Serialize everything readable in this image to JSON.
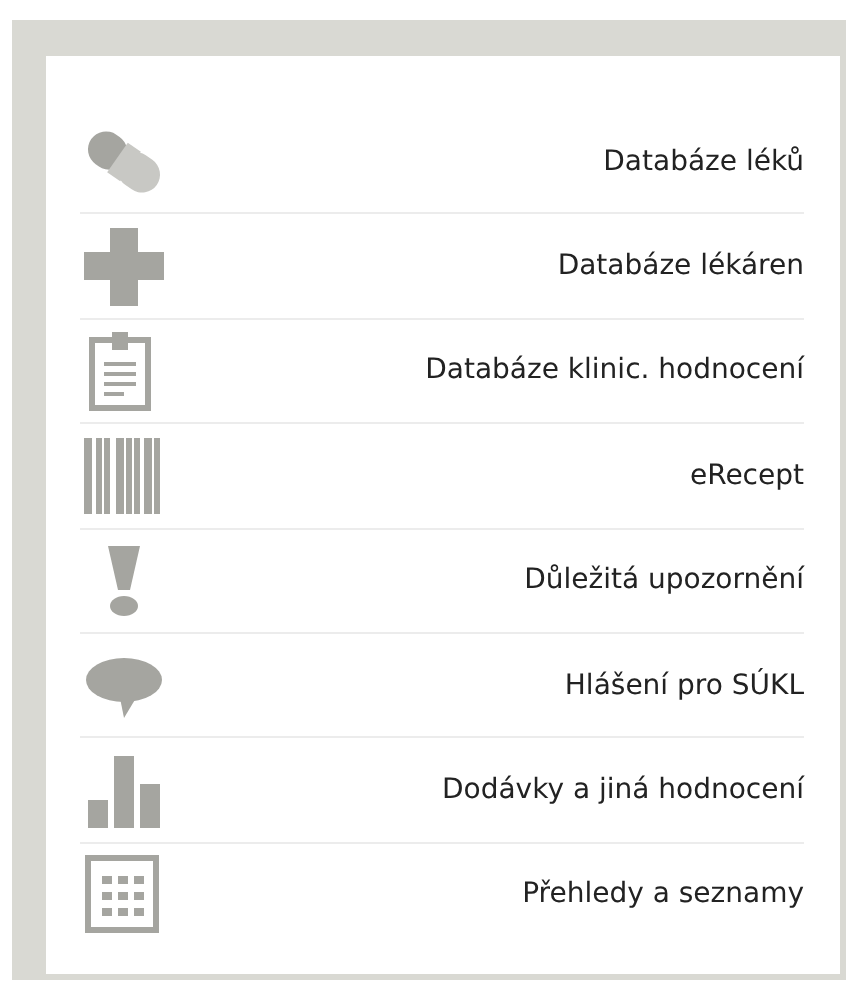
{
  "menu": {
    "items": [
      {
        "kind": "pill",
        "label": "Databáze léků"
      },
      {
        "kind": "cross",
        "label": "Databáze lékáren"
      },
      {
        "kind": "clipboard",
        "label": "Databáze klinic. hodnocení"
      },
      {
        "kind": "barcode",
        "label": "eRecept"
      },
      {
        "kind": "exclamation",
        "label": "Důležitá upozornění"
      },
      {
        "kind": "speech",
        "label": "Hlášení pro SÚKL"
      },
      {
        "kind": "bars",
        "label": "Dodávky a jiná hodnocení"
      },
      {
        "kind": "grid",
        "label": "Přehledy a seznamy"
      }
    ]
  }
}
